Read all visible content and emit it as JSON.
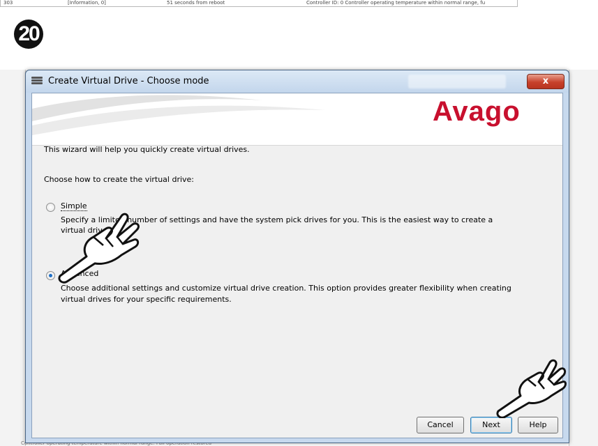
{
  "background_log": {
    "row_id": "303",
    "row_type": "[Information, 0]",
    "row_time": "51 seconds from reboot",
    "row_desc": "Controller ID: 0  Controller operating temperature within normal range, fu",
    "bottom_text": "Controller operating temperature within normal range. Full operation restored"
  },
  "step": {
    "number": "20"
  },
  "window": {
    "title": "Create Virtual Drive - Choose mode",
    "close_label": "x",
    "logo_text": "Avago"
  },
  "intro": {
    "line1": "This wizard will help you quickly create virtual drives.",
    "line2": "Choose how to create the virtual drive:"
  },
  "options": {
    "simple": {
      "label": "Simple",
      "checked": false,
      "desc_line1": "Specify a limited number of settings and have the system pick drives for you. This is the easiest way to create a",
      "desc_line2": "virtual drive."
    },
    "advanced": {
      "label": "Advanced",
      "checked": true,
      "desc_line1": "Choose additional settings and customize virtual drive creation. This option provides greater flexibility when creating",
      "desc_line2": "virtual drives for your specific requirements."
    }
  },
  "buttons": {
    "cancel": "Cancel",
    "next": "Next",
    "help": "Help"
  },
  "colors": {
    "logo": "#c8102e",
    "accent": "#1f6fc5"
  }
}
